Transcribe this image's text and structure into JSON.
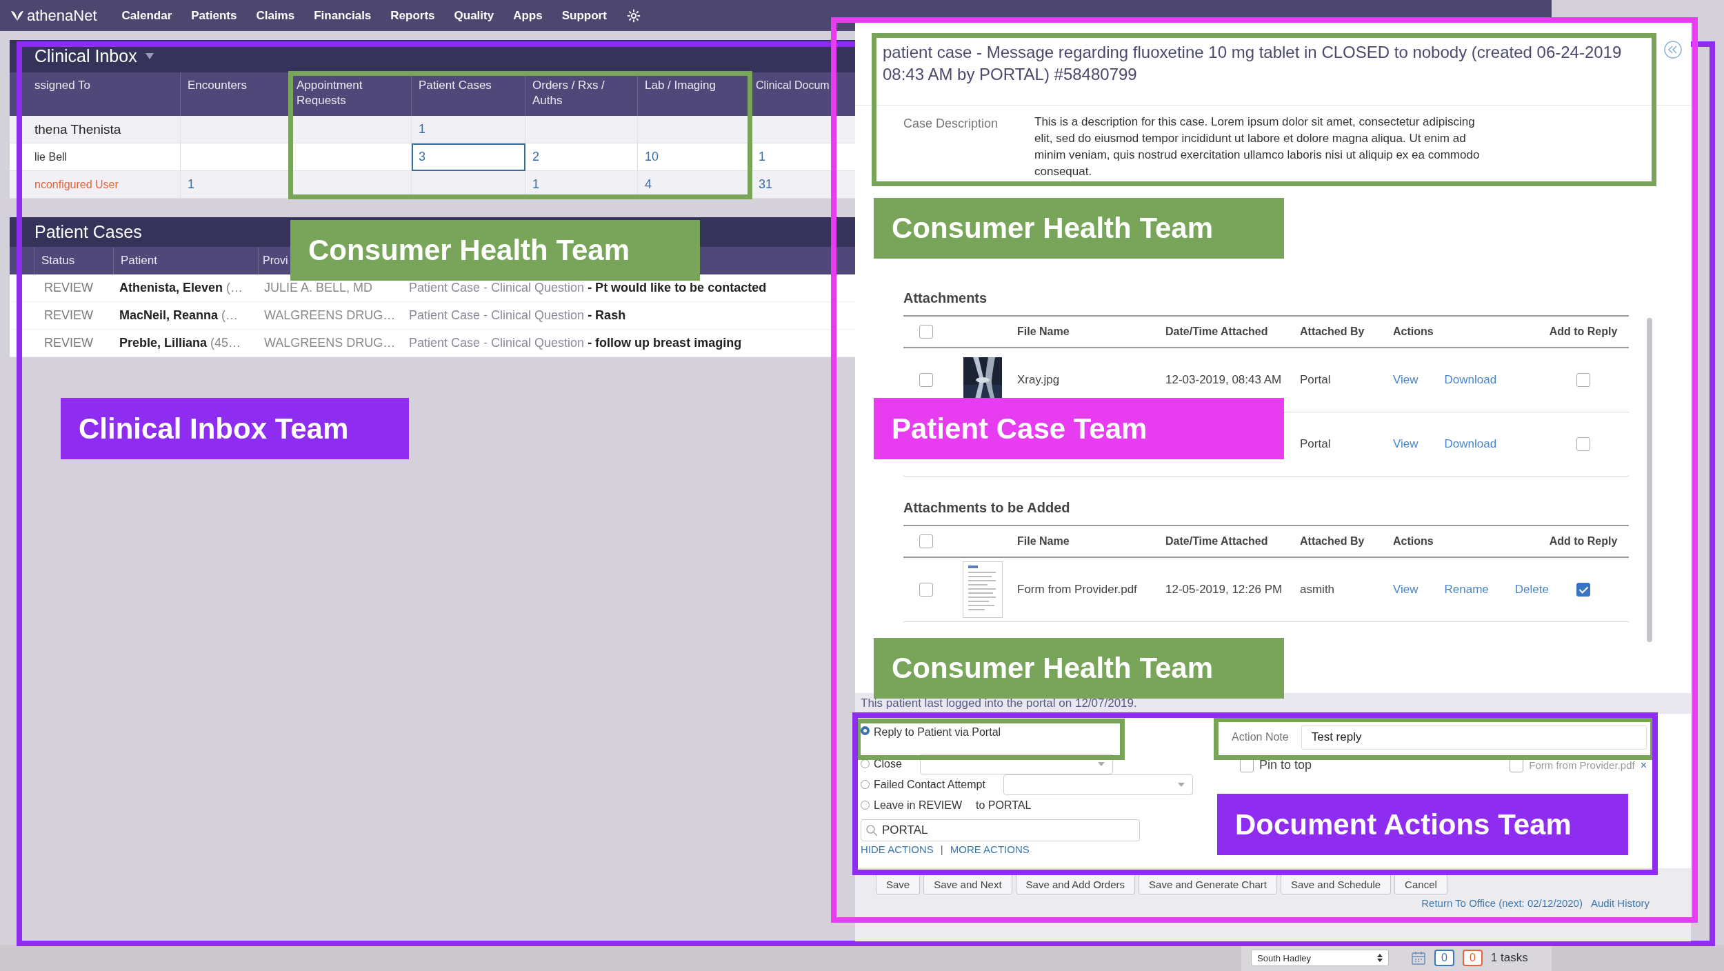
{
  "top_nav": {
    "logo": "athenaNet",
    "items": [
      "Calendar",
      "Patients",
      "Claims",
      "Financials",
      "Reports",
      "Quality",
      "Apps",
      "Support"
    ]
  },
  "clinical_inbox": {
    "title": "Clinical Inbox",
    "assignee_column": "ssigned To",
    "columns": [
      "Encounters",
      "Appointment Requests",
      "Patient Cases",
      "Orders / Rxs / Auths",
      "Lab / Imaging",
      "Clinical Docum"
    ],
    "rows": [
      {
        "name": "thena Thenista",
        "kind": "current",
        "cells": [
          null,
          null,
          {
            "text": "1",
            "selected": false
          },
          null,
          null,
          null
        ]
      },
      {
        "name": "lie Bell",
        "kind": "normal",
        "cells": [
          null,
          null,
          {
            "text": "3",
            "selected": true
          },
          {
            "text": "2",
            "selected": false
          },
          {
            "text": "10",
            "selected": false
          },
          {
            "text": "1",
            "selected": false
          }
        ]
      },
      {
        "name": "nconfigured User",
        "kind": "unconfigured",
        "cells": [
          {
            "text": "1",
            "selected": false
          },
          null,
          null,
          {
            "text": "1",
            "selected": false
          },
          {
            "text": "4",
            "selected": false
          },
          {
            "text": "31",
            "selected": false
          }
        ]
      }
    ]
  },
  "patient_cases": {
    "title": "Patient Cases",
    "columns": [
      "Status",
      "Patient",
      "Provi"
    ],
    "rows": [
      {
        "status": "REVIEW",
        "patient": "**Athenista, Eleven** (…",
        "provider": "JULIE A. BELL, MD",
        "subject": "Patient Case - Clinical Question **- Pt would like to be contacted**"
      },
      {
        "status": "REVIEW",
        "patient": "**MacNeil, Reanna** (…",
        "provider": "WALGREENS DRUG…",
        "subject": "Patient Case - Clinical Question **- Rash**"
      },
      {
        "status": "REVIEW",
        "patient": "**Preble, Lilliana** (45…",
        "provider": "WALGREENS DRUG…",
        "subject": "Patient Case - Clinical Question **- follow up breast imaging**"
      }
    ]
  },
  "case_panel": {
    "title": "patient case - Message regarding fluoxetine 10 mg tablet in CLOSED to nobody (created 06-24-2019 08:43 AM by PORTAL) #58480799",
    "description_label": "Case Description",
    "description": "This is a description for this case. Lorem ipsum dolor sit amet, consectetur adipiscing elit, sed do eiusmod tempor incididunt ut labore et dolore magna aliqua. Ut enim ad minim veniam, quis nostrud exercitation ullamco laboris nisi ut aliquip ex ea commodo consequat.",
    "attachment_tables": [
      {
        "heading": "Attachments",
        "columns": [
          "File Name",
          "Date/Time Attached",
          "Attached By",
          "Actions",
          "Add to Reply"
        ],
        "all_checked": false,
        "rows": [
          {
            "kind": "picture",
            "file_name": "Xray.jpg",
            "date": "12-03-2019, 08:43 AM",
            "attached_by": "Portal",
            "actions": [
              "View",
              "Download"
            ],
            "checked": false,
            "add_to_reply": false
          },
          {
            "kind": "plain",
            "attached_by": "Portal",
            "actions": [
              "View",
              "Download"
            ],
            "add_to_reply": false
          }
        ]
      },
      {
        "heading": "Attachments to be Added",
        "columns": [
          "File Name",
          "Date/Time Attached",
          "Attached By",
          "Actions",
          "Add to Reply"
        ],
        "all_checked": false,
        "rows": [
          {
            "kind": "document",
            "file_name": "Form from Provider.pdf",
            "date": "12-05-2019, 12:26 PM",
            "attached_by": "asmith",
            "actions": [
              "View",
              "Rename",
              "Delete"
            ],
            "checked": false,
            "add_to_reply": true
          }
        ]
      }
    ],
    "portal_notice": "This patient last logged into the portal on 12/07/2019.",
    "options": [
      {
        "kind": "radio",
        "label": "Reply to Patient via Portal",
        "selected": true
      },
      {
        "kind": "radio_select",
        "label": "Close",
        "selected": false
      },
      {
        "kind": "radio_select",
        "label": "Failed Contact Attempt",
        "selected": false
      },
      {
        "kind": "radio_suffix",
        "label": "Leave in REVIEW",
        "suffix": "to PORTAL",
        "selected": false
      }
    ],
    "search": {
      "value": "PORTAL"
    },
    "action_links": [
      "HIDE ACTIONS",
      "MORE ACTIONS"
    ],
    "link_separator": "|",
    "action_note": {
      "label": "Action Note",
      "value": "Test reply"
    },
    "pin_to_top": {
      "label": "Pin to top",
      "checked": false
    },
    "attachment_to_send": {
      "label": "Form from Provider.pdf",
      "checked": false,
      "remove_glyph": "×"
    },
    "buttons": [
      "Save",
      "Save and Next",
      "Save and Add Orders",
      "Save and Generate Chart",
      "Save and Schedule",
      "Cancel"
    ],
    "footer_links": [
      "Return To Office (next: 02/12/2020)",
      "Audit History"
    ]
  },
  "status_bar": {
    "department": "South Hadley",
    "badges": [
      {
        "text": "0",
        "color": "#3b78b8"
      },
      {
        "text": "0",
        "color": "#e0643c"
      }
    ],
    "tasks": "1 tasks"
  },
  "annotations": [
    {
      "kind": "frame",
      "color": "#8e2cf0"
    },
    {
      "kind": "frame",
      "color": "#e83cf0"
    },
    {
      "kind": "frame",
      "color": "#78a55a"
    },
    {
      "kind": "frame",
      "color": "#78a55a"
    },
    {
      "kind": "label",
      "color": "#78a55a",
      "text": "Consumer Health Team"
    },
    {
      "kind": "label",
      "color": "#78a55a",
      "text": "Consumer Health Team"
    },
    {
      "kind": "label",
      "color": "#8e2cf0",
      "text": "Clinical Inbox Team"
    },
    {
      "kind": "label",
      "color": "#e83cf0",
      "text": "Patient Case Team"
    },
    {
      "kind": "label",
      "color": "#78a55a",
      "text": "Consumer Health Team"
    },
    {
      "kind": "frame",
      "color": "#78a55a"
    },
    {
      "kind": "frame",
      "color": "#78a55a"
    },
    {
      "kind": "frame",
      "color": "#8e2cf0"
    },
    {
      "kind": "label",
      "color": "#8e2cf0",
      "text": "Document Actions Team"
    }
  ]
}
